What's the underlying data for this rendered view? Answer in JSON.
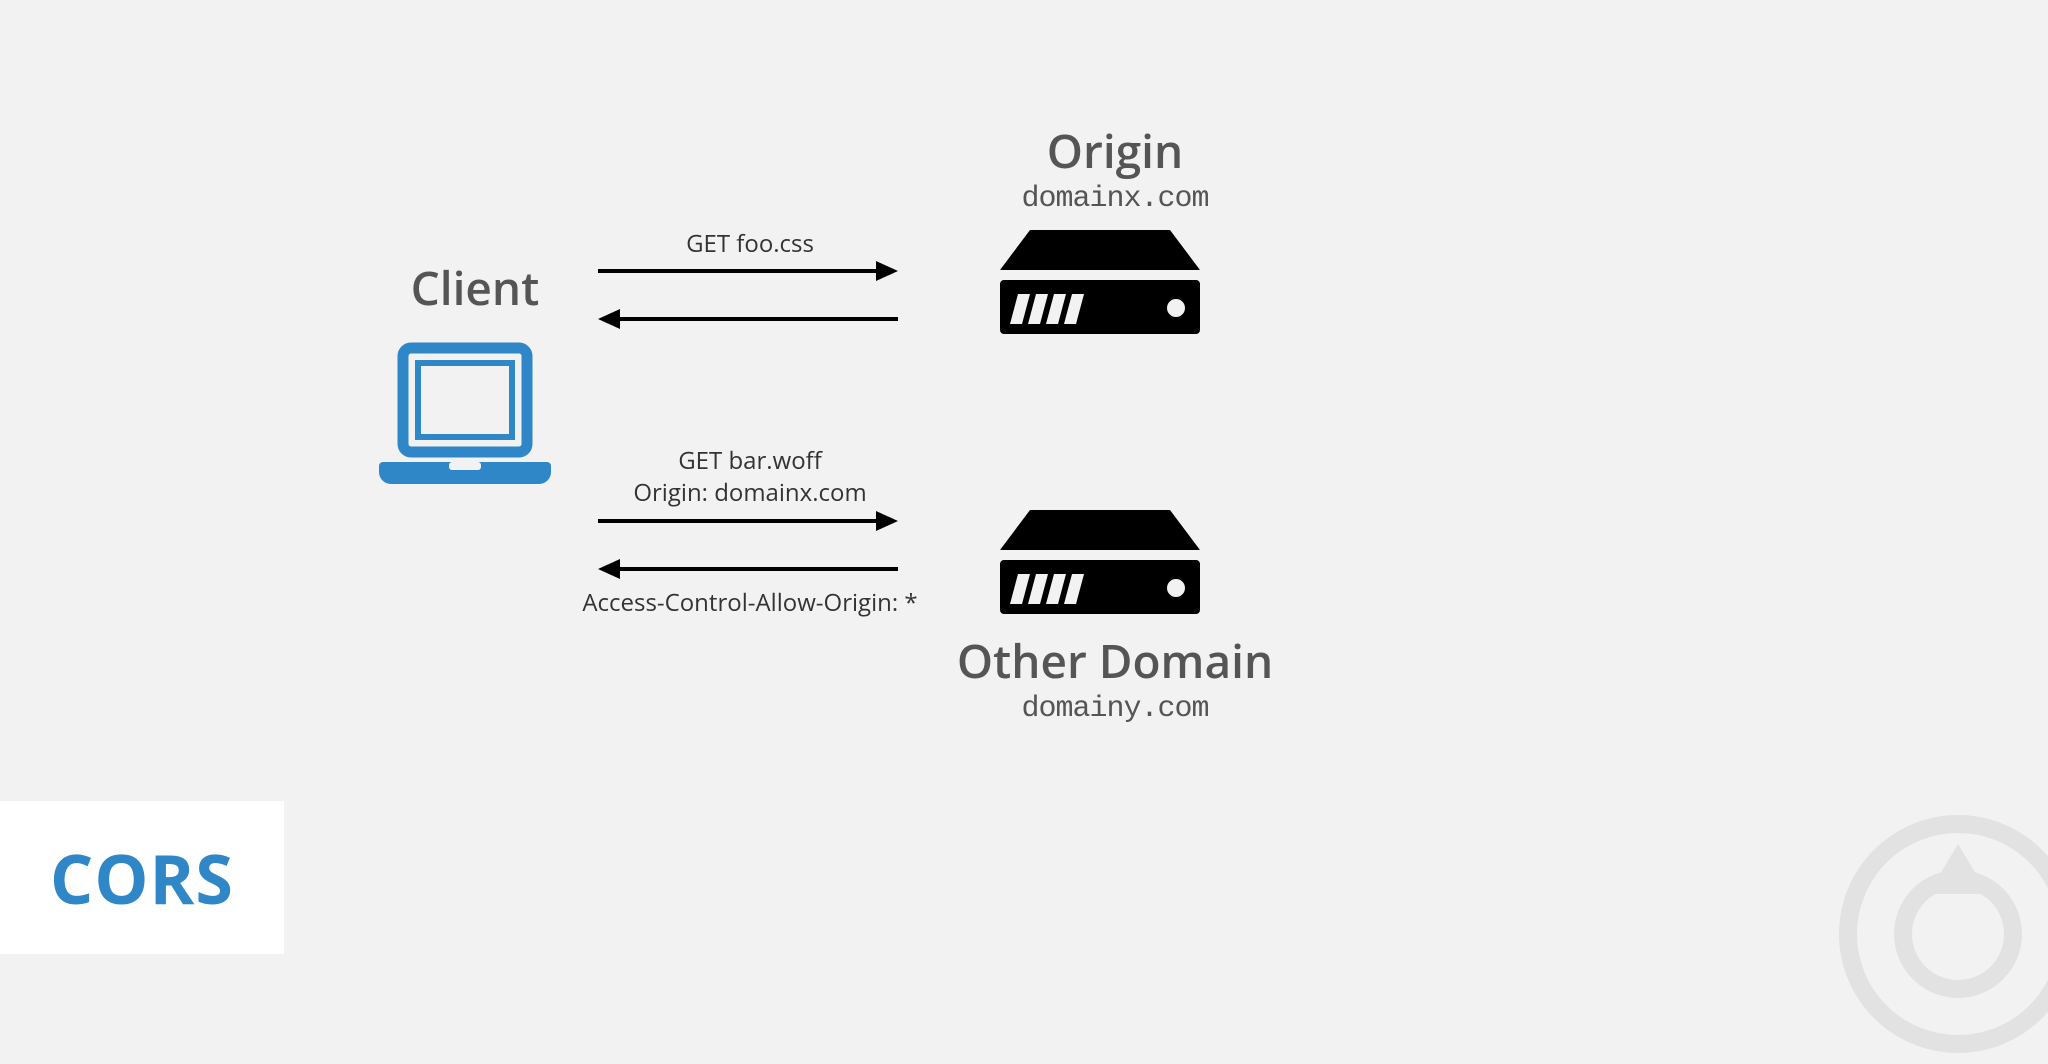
{
  "client": {
    "label": "Client"
  },
  "origin": {
    "title": "Origin",
    "domain": "domainx.com"
  },
  "other": {
    "title": "Other Domain",
    "domain": "domainy.com"
  },
  "req1": {
    "label": "GET foo.css"
  },
  "req2": {
    "line1": "GET bar.woff",
    "line2": "Origin: domainx.com"
  },
  "resp2": {
    "label": "Access-Control-Allow-Origin: *"
  },
  "banner": {
    "title": "CORS"
  },
  "colors": {
    "client_blue": "#2f87c8",
    "text_gray": "#555",
    "black": "#000"
  }
}
